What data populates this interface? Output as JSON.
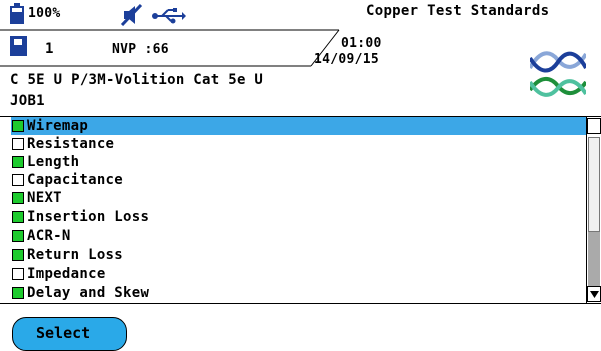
{
  "status": {
    "battery": "100%",
    "title": "Copper Test Standards",
    "slot": "1",
    "nvp": "NVP :66",
    "time": "01:00",
    "date": "14/09/15"
  },
  "cable": {
    "standard": "C 5E U P/3M-Volition Cat 5e U",
    "job": "JOB1"
  },
  "tests": [
    {
      "label": "Wiremap",
      "checked": true,
      "selected": true
    },
    {
      "label": "Resistance",
      "checked": false,
      "selected": false
    },
    {
      "label": "Length",
      "checked": true,
      "selected": false
    },
    {
      "label": "Capacitance",
      "checked": false,
      "selected": false
    },
    {
      "label": "NEXT",
      "checked": true,
      "selected": false
    },
    {
      "label": "Insertion Loss",
      "checked": true,
      "selected": false
    },
    {
      "label": "ACR-N",
      "checked": true,
      "selected": false
    },
    {
      "label": "Return Loss",
      "checked": true,
      "selected": false
    },
    {
      "label": "Impedance",
      "checked": false,
      "selected": false
    },
    {
      "label": "Delay and Skew",
      "checked": true,
      "selected": false
    }
  ],
  "actions": {
    "select": "Select"
  },
  "icons": {
    "battery": "battery-icon",
    "sd": "sd-card-icon",
    "mute": "speaker-mute-icon",
    "usb": "usb-icon",
    "logo": "twisted-pair-logo"
  },
  "colors": {
    "highlight": "#3ca7e7",
    "pass": "#1ecb2e",
    "button": "#2aa9e8",
    "icon": "#1c3f9a"
  }
}
